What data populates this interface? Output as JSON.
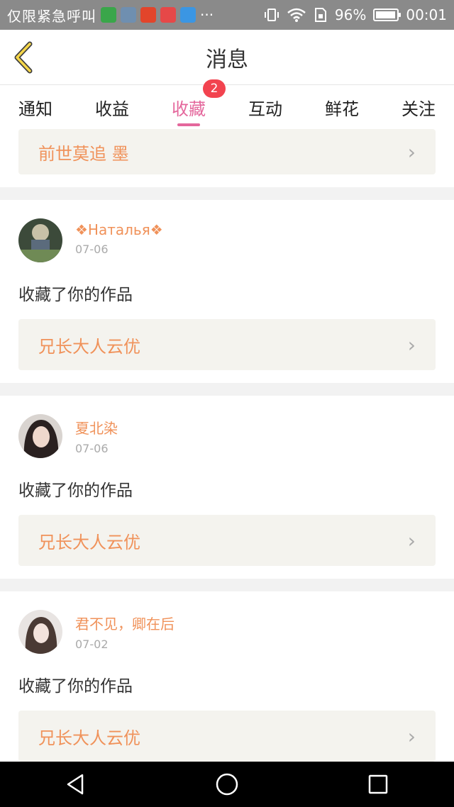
{
  "status_bar": {
    "carrier": "仅限紧急呼叫",
    "battery": "96%",
    "battery_level": 0.96,
    "time": "00:01",
    "more": "···"
  },
  "header": {
    "title": "消息"
  },
  "tabs": [
    {
      "label": "通知"
    },
    {
      "label": "收益"
    },
    {
      "label": "收藏",
      "badge": "2",
      "active": true
    },
    {
      "label": "互动"
    },
    {
      "label": "鲜花"
    },
    {
      "label": "关注"
    }
  ],
  "partial_item": {
    "work_title": "前世莫追 墨"
  },
  "items": [
    {
      "user": "❖Наталья❖",
      "date": "07-06",
      "action": "收藏了你的作品",
      "work_title": "兄长大人云优"
    },
    {
      "user": "夏北染",
      "date": "07-06",
      "action": "收藏了你的作品",
      "work_title": "兄长大人云优"
    },
    {
      "user": "君不见，卿在后",
      "date": "07-02",
      "action": "收藏了你的作品",
      "work_title": "兄长大人云优"
    }
  ],
  "colors": {
    "accent": "#e4679c",
    "name": "#f0925a",
    "badge": "#f2434f"
  }
}
